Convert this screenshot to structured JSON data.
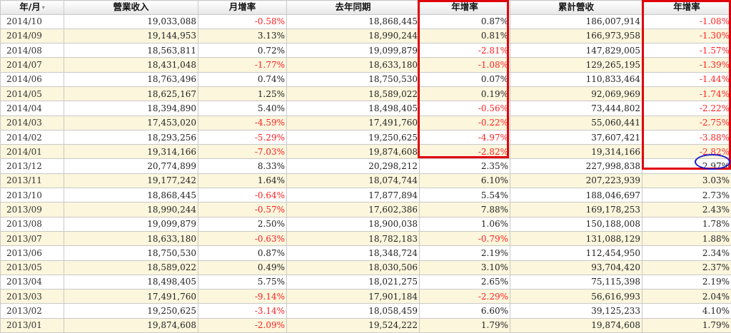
{
  "headers": {
    "month": "年/月",
    "revenue": "營業收入",
    "mom": "月增率",
    "prev_year": "去年同期",
    "yoy": "年增率",
    "cumulative": "累計營收",
    "cum_yoy": "年增率"
  },
  "sort_icon": "sort-arrows-icon",
  "colors": {
    "negative": "#ff2020",
    "highlight_box": "#e0000a",
    "highlight_ellipse": "#1a1acc",
    "row_alt": "#fbf6dc"
  },
  "rows": [
    {
      "month": "2014/10",
      "revenue": "19,033,088",
      "mom": "-0.58%",
      "prev_year": "18,868,445",
      "yoy": "0.87%",
      "cumulative": "186,007,914",
      "cum_yoy": "-1.08%"
    },
    {
      "month": "2014/09",
      "revenue": "19,144,953",
      "mom": "3.13%",
      "prev_year": "18,990,244",
      "yoy": "0.81%",
      "cumulative": "166,973,958",
      "cum_yoy": "-1.30%"
    },
    {
      "month": "2014/08",
      "revenue": "18,563,811",
      "mom": "0.72%",
      "prev_year": "19,099,879",
      "yoy": "-2.81%",
      "cumulative": "147,829,005",
      "cum_yoy": "-1.57%"
    },
    {
      "month": "2014/07",
      "revenue": "18,431,048",
      "mom": "-1.77%",
      "prev_year": "18,633,180",
      "yoy": "-1.08%",
      "cumulative": "129,265,195",
      "cum_yoy": "-1.39%"
    },
    {
      "month": "2014/06",
      "revenue": "18,763,496",
      "mom": "0.74%",
      "prev_year": "18,750,530",
      "yoy": "0.07%",
      "cumulative": "110,833,464",
      "cum_yoy": "-1.44%"
    },
    {
      "month": "2014/05",
      "revenue": "18,625,167",
      "mom": "1.25%",
      "prev_year": "18,589,022",
      "yoy": "0.19%",
      "cumulative": "92,069,969",
      "cum_yoy": "-1.74%"
    },
    {
      "month": "2014/04",
      "revenue": "18,394,890",
      "mom": "5.40%",
      "prev_year": "18,498,405",
      "yoy": "-0.56%",
      "cumulative": "73,444,802",
      "cum_yoy": "-2.22%"
    },
    {
      "month": "2014/03",
      "revenue": "17,453,020",
      "mom": "-4.59%",
      "prev_year": "17,491,760",
      "yoy": "-0.22%",
      "cumulative": "55,060,441",
      "cum_yoy": "-2.75%"
    },
    {
      "month": "2014/02",
      "revenue": "18,293,256",
      "mom": "-5.29%",
      "prev_year": "19,250,625",
      "yoy": "-4.97%",
      "cumulative": "37,607,421",
      "cum_yoy": "-3.88%"
    },
    {
      "month": "2014/01",
      "revenue": "19,314,166",
      "mom": "-7.03%",
      "prev_year": "19,874,608",
      "yoy": "-2.82%",
      "cumulative": "19,314,166",
      "cum_yoy": "-2.82%"
    },
    {
      "month": "2013/12",
      "revenue": "20,774,899",
      "mom": "8.33%",
      "prev_year": "20,298,212",
      "yoy": "2.35%",
      "cumulative": "227,998,838",
      "cum_yoy": "2.97%"
    },
    {
      "month": "2013/11",
      "revenue": "19,177,242",
      "mom": "1.64%",
      "prev_year": "18,074,744",
      "yoy": "6.10%",
      "cumulative": "207,223,939",
      "cum_yoy": "3.03%"
    },
    {
      "month": "2013/10",
      "revenue": "18,868,445",
      "mom": "-0.64%",
      "prev_year": "17,877,894",
      "yoy": "5.54%",
      "cumulative": "188,046,697",
      "cum_yoy": "2.73%"
    },
    {
      "month": "2013/09",
      "revenue": "18,990,244",
      "mom": "-0.57%",
      "prev_year": "17,602,386",
      "yoy": "7.88%",
      "cumulative": "169,178,253",
      "cum_yoy": "2.43%"
    },
    {
      "month": "2013/08",
      "revenue": "19,099,879",
      "mom": "2.50%",
      "prev_year": "18,900,038",
      "yoy": "1.06%",
      "cumulative": "150,188,008",
      "cum_yoy": "1.78%"
    },
    {
      "month": "2013/07",
      "revenue": "18,633,180",
      "mom": "-0.63%",
      "prev_year": "18,782,183",
      "yoy": "-0.79%",
      "cumulative": "131,088,129",
      "cum_yoy": "1.88%"
    },
    {
      "month": "2013/06",
      "revenue": "18,750,530",
      "mom": "0.87%",
      "prev_year": "18,348,724",
      "yoy": "2.19%",
      "cumulative": "112,454,950",
      "cum_yoy": "2.34%"
    },
    {
      "month": "2013/05",
      "revenue": "18,589,022",
      "mom": "0.49%",
      "prev_year": "18,030,506",
      "yoy": "3.10%",
      "cumulative": "93,704,420",
      "cum_yoy": "2.37%"
    },
    {
      "month": "2013/04",
      "revenue": "18,498,405",
      "mom": "5.75%",
      "prev_year": "18,021,275",
      "yoy": "2.65%",
      "cumulative": "75,115,398",
      "cum_yoy": "2.19%"
    },
    {
      "month": "2013/03",
      "revenue": "17,491,760",
      "mom": "-9.14%",
      "prev_year": "17,901,184",
      "yoy": "-2.29%",
      "cumulative": "56,616,993",
      "cum_yoy": "2.04%"
    },
    {
      "month": "2013/02",
      "revenue": "19,250,625",
      "mom": "-3.14%",
      "prev_year": "18,058,459",
      "yoy": "6.60%",
      "cumulative": "39,125,233",
      "cum_yoy": "4.10%"
    },
    {
      "month": "2013/01",
      "revenue": "19,874,608",
      "mom": "-2.09%",
      "prev_year": "19,524,222",
      "yoy": "1.79%",
      "cumulative": "19,874,608",
      "cum_yoy": "1.79%"
    }
  ]
}
